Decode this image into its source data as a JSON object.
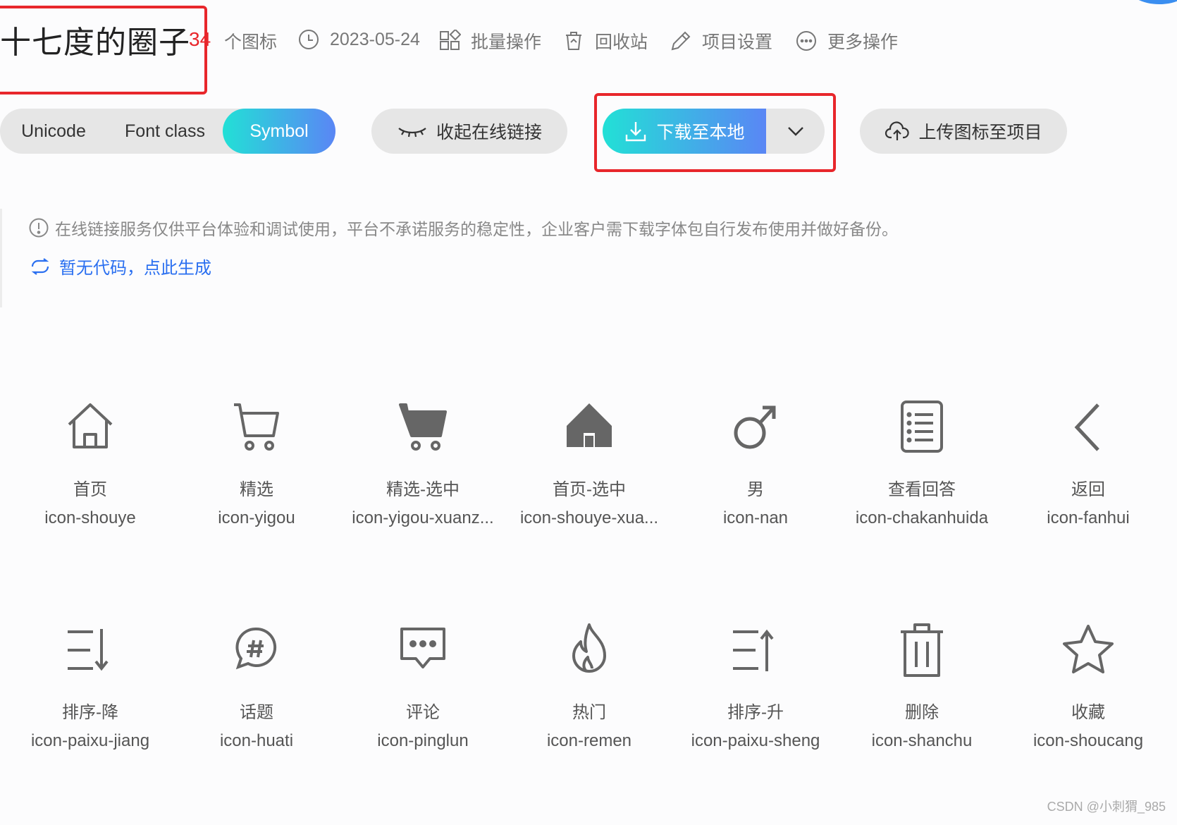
{
  "header": {
    "title": "十七度的圈子",
    "icon_count": "34",
    "icon_count_suffix": "个图标",
    "date": "2023-05-24",
    "batch_ops": "批量操作",
    "recycle": "回收站",
    "settings": "项目设置",
    "more_ops": "更多操作"
  },
  "toolbar": {
    "tabs": [
      "Unicode",
      "Font class",
      "Symbol"
    ],
    "active_tab": "Symbol",
    "collapse_link": "收起在线链接",
    "download": "下载至本地",
    "upload": "上传图标至项目"
  },
  "notice": {
    "text": "在线链接服务仅供平台体验和调试使用，平台不承诺服务的稳定性，企业客户需下载字体包自行发布使用并做好备份。",
    "generate": "暂无代码，点此生成"
  },
  "icons": [
    {
      "name": "首页",
      "code": "icon-shouye",
      "icon": "home-outline-icon"
    },
    {
      "name": "精选",
      "code": "icon-yigou",
      "icon": "cart-outline-icon"
    },
    {
      "name": "精选-选中",
      "code": "icon-yigou-xuanz...",
      "icon": "cart-filled-icon"
    },
    {
      "name": "首页-选中",
      "code": "icon-shouye-xua...",
      "icon": "home-filled-icon"
    },
    {
      "name": "男",
      "code": "icon-nan",
      "icon": "male-icon"
    },
    {
      "name": "查看回答",
      "code": "icon-chakanhuida",
      "icon": "list-document-icon"
    },
    {
      "name": "返回",
      "code": "icon-fanhui",
      "icon": "chevron-left-icon"
    },
    {
      "name": "排序-降",
      "code": "icon-paixu-jiang",
      "icon": "sort-descending-icon"
    },
    {
      "name": "话题",
      "code": "icon-huati",
      "icon": "hashtag-bubble-icon"
    },
    {
      "name": "评论",
      "code": "icon-pinglun",
      "icon": "comment-icon"
    },
    {
      "name": "热门",
      "code": "icon-remen",
      "icon": "flame-icon"
    },
    {
      "name": "排序-升",
      "code": "icon-paixu-sheng",
      "icon": "sort-ascending-icon"
    },
    {
      "name": "删除",
      "code": "icon-shanchu",
      "icon": "trash-icon"
    },
    {
      "name": "收藏",
      "code": "icon-shoucang",
      "icon": "star-icon"
    }
  ],
  "watermark": "CSDN @小刺猬_985"
}
